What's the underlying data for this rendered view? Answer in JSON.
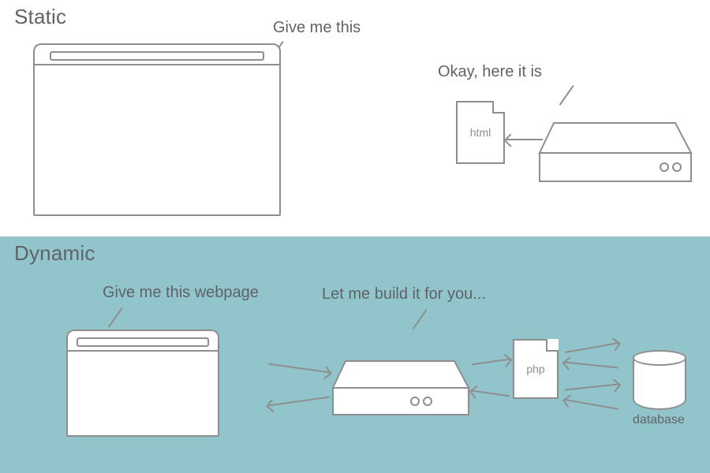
{
  "static": {
    "title": "Static",
    "request_label": "Give me this",
    "response_label": "Okay, here it is",
    "file_label": "html"
  },
  "dynamic": {
    "title": "Dynamic",
    "request_label": "Give me this webpage",
    "response_label": "Let me build it for you...",
    "file_label": "php",
    "database_label": "database"
  }
}
